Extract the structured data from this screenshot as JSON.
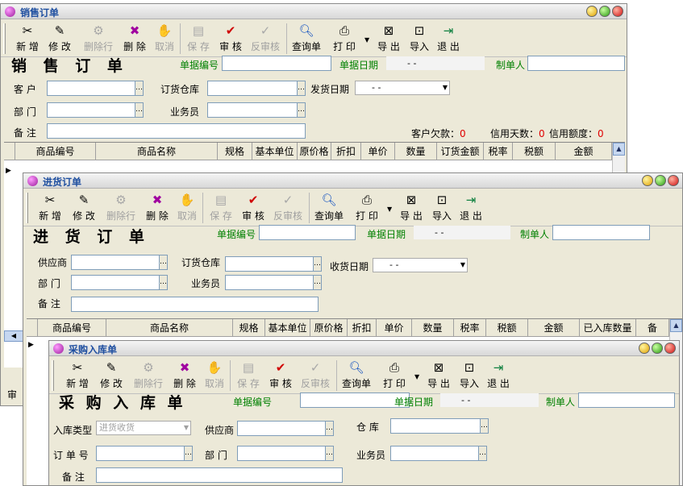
{
  "toolbar": {
    "new": "新 增",
    "edit": "修 改",
    "delrow": "删除行",
    "delete": "删 除",
    "cancel": "取消",
    "save": "保 存",
    "audit": "审 核",
    "unaudit": "反审核",
    "query": "查询单",
    "print": "打 印",
    "export": "导 出",
    "import": "导入",
    "exit": "退 出"
  },
  "sales": {
    "window_title": "销售订单",
    "form_title": "销 售 订 单",
    "bill_no_label": "单据编号",
    "bill_date_label": "单据日期",
    "bill_date": "-   -",
    "maker_label": "制单人",
    "customer_label": "客  户",
    "warehouse_label": "订货仓库",
    "ship_date_label": "发货日期",
    "ship_date": "-   -",
    "dept_label": "部  门",
    "salesman_label": "业务员",
    "remark_label": "备  注",
    "arrears_label": "客户欠款：",
    "arrears": "0",
    "credit_days_label": "信用天数：",
    "credit_days": "0",
    "credit_limit_label": "信用额度：",
    "credit_limit": "0",
    "columns": [
      "商品编号",
      "商品名称",
      "规格",
      "基本单位",
      "原价格",
      "折扣",
      "单价",
      "数量",
      "订货金额",
      "税率",
      "税额",
      "金额"
    ],
    "frag_label": "审"
  },
  "purchase": {
    "window_title": "进货订单",
    "form_title": "进 货 订 单",
    "bill_no_label": "单据编号",
    "bill_date_label": "单据日期",
    "bill_date": "-   -",
    "maker_label": "制单人",
    "supplier_label": "供应商",
    "warehouse_label": "订货仓库",
    "recv_date_label": "收货日期",
    "recv_date": "-   -",
    "dept_label": "部  门",
    "salesman_label": "业务员",
    "remark_label": "备  注",
    "columns": [
      "商品编号",
      "商品名称",
      "规格",
      "基本单位",
      "原价格",
      "折扣",
      "单价",
      "数量",
      "税率",
      "税额",
      "金额",
      "已入库数量",
      "备"
    ]
  },
  "inbound": {
    "window_title": "采购入库单",
    "form_title": "采 购 入 库 单",
    "bill_no_label": "单据编号",
    "bill_date_label": "单据日期",
    "bill_date": "-   -",
    "maker_label": "制单人",
    "type_label": "入库类型",
    "type_value": "进货收货",
    "supplier_label": "供应商",
    "warehouse_label": "仓  库",
    "order_no_label": "订 单 号",
    "dept_label": "部  门",
    "salesman_label": "业务员",
    "remark_label": "备  注"
  },
  "colors": {
    "title_text": "#1f4fa0",
    "green_label": "#008000",
    "red_value": "#e00000"
  }
}
